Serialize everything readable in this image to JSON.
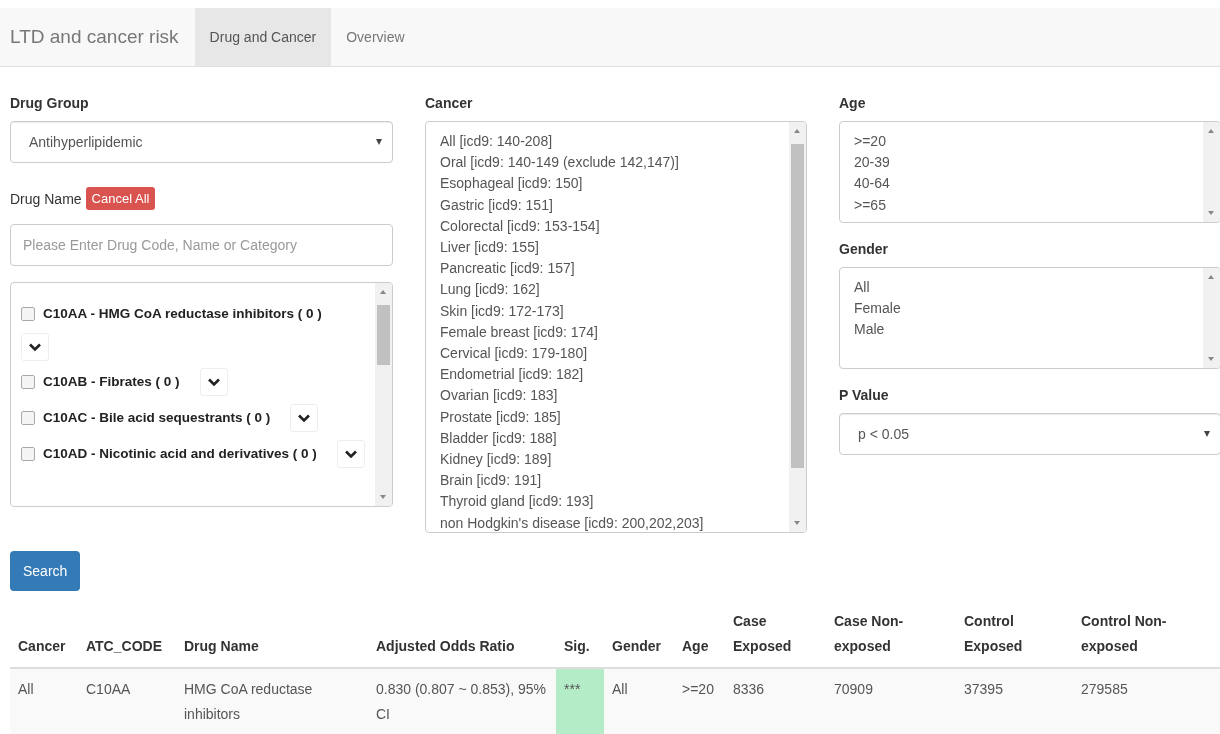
{
  "navbar": {
    "brand": "LTD and cancer risk",
    "tabs": [
      {
        "label": "Drug and Cancer",
        "selected": true
      },
      {
        "label": "Overview",
        "selected": false
      }
    ]
  },
  "drug_group": {
    "label": "Drug Group",
    "value": "Antihyperlipidemic"
  },
  "drug_name": {
    "label": "Drug Name",
    "cancel_button": "Cancel All",
    "search": {
      "placeholder": "Please Enter Drug Code, Name or Category"
    },
    "items": [
      {
        "label": "C10AA - HMG CoA reductase inhibitors ( 0 )",
        "checked": false
      },
      {
        "label": "C10AB - Fibrates ( 0 )",
        "checked": false
      },
      {
        "label": "C10AC - Bile acid sequestrants ( 0 )",
        "checked": false
      },
      {
        "label": "C10AD - Nicotinic acid and derivatives ( 0 )",
        "checked": false
      }
    ]
  },
  "cancer": {
    "label": "Cancer",
    "options": [
      "All [icd9: 140-208]",
      "Oral [icd9: 140-149 (exclude 142,147)]",
      "Esophageal [icd9: 150]",
      "Gastric [icd9: 151]",
      "Colorectal [icd9: 153-154]",
      "Liver [icd9: 155]",
      "Pancreatic [icd9: 157]",
      "Lung [icd9: 162]",
      "Skin [icd9: 172-173]",
      "Female breast [icd9: 174]",
      "Cervical [icd9: 179-180]",
      "Endometrial [icd9: 182]",
      "Ovarian [icd9: 183]",
      "Prostate [icd9: 185]",
      "Bladder [icd9: 188]",
      "Kidney [icd9: 189]",
      "Brain [icd9: 191]",
      "Thyroid gland [icd9: 193]",
      "non Hodgkin's disease [icd9: 200,202,203]"
    ]
  },
  "age": {
    "label": "Age",
    "options": [
      ">=20",
      "20-39",
      "40-64",
      ">=65"
    ]
  },
  "gender": {
    "label": "Gender",
    "options": [
      "All",
      "Female",
      "Male"
    ]
  },
  "p_value": {
    "label": "P Value",
    "value": "p < 0.05"
  },
  "search_button": "Search",
  "table": {
    "columns": [
      "Cancer",
      "ATC_CODE",
      "Drug Name",
      "Adjusted Odds Ratio",
      "Sig.",
      "Gender",
      "Age",
      "Case Exposed",
      "Case Non-exposed",
      "Control Exposed",
      "Control Non-exposed"
    ],
    "rows": [
      {
        "cells": [
          "All",
          "C10AA",
          "HMG CoA reductase inhibitors",
          "0.830 (0.807 ~ 0.853), 95% CI",
          "***",
          "All",
          ">=20",
          "8336",
          "70909",
          "37395",
          "279585"
        ],
        "significant": true
      }
    ]
  }
}
